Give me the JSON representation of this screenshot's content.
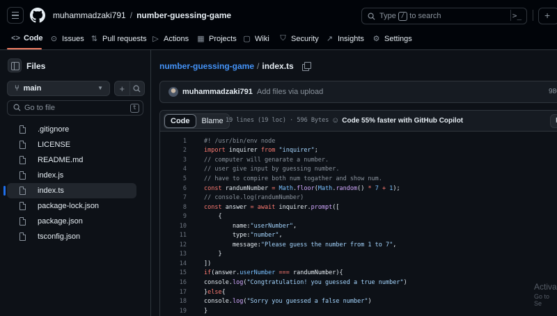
{
  "header": {
    "owner": "muhammadzaki791",
    "separator": "/",
    "repo": "number-guessing-game",
    "search_prefix": "Type",
    "search_key": "/",
    "search_suffix": "to search",
    "command_glyph": ">_",
    "plus_glyph": "+"
  },
  "nav": {
    "tabs": [
      {
        "label": "Code",
        "icon": "code-icon",
        "glyph": "<>"
      },
      {
        "label": "Issues",
        "icon": "issue-icon",
        "glyph": "⊙"
      },
      {
        "label": "Pull requests",
        "icon": "pull-request-icon",
        "glyph": "⇅"
      },
      {
        "label": "Actions",
        "icon": "play-icon",
        "glyph": "▷"
      },
      {
        "label": "Projects",
        "icon": "table-icon",
        "glyph": "▦"
      },
      {
        "label": "Wiki",
        "icon": "book-icon",
        "glyph": "▢"
      },
      {
        "label": "Security",
        "icon": "shield-icon",
        "glyph": "⛉"
      },
      {
        "label": "Insights",
        "icon": "graph-icon",
        "glyph": "↗"
      },
      {
        "label": "Settings",
        "icon": "gear-icon",
        "glyph": "⚙"
      }
    ],
    "active_tab": "Code"
  },
  "sidebar": {
    "title": "Files",
    "branch": "main",
    "add_glyph": "+",
    "goto_placeholder": "Go to file",
    "goto_key": "t",
    "files": [
      {
        "name": ".gitignore"
      },
      {
        "name": "LICENSE"
      },
      {
        "name": "README.md"
      },
      {
        "name": "index.js"
      },
      {
        "name": "index.ts",
        "selected": true
      },
      {
        "name": "package-lock.json"
      },
      {
        "name": "package.json"
      },
      {
        "name": "tsconfig.json"
      }
    ]
  },
  "main": {
    "breadcrumb_repo": "number-guessing-game",
    "breadcrumb_sep": "/",
    "breadcrumb_file": "index.ts",
    "commit": {
      "user": "muhammadzaki791",
      "message": "Add files via upload",
      "sha_partial": "980"
    },
    "code_view": {
      "tab_code": "Code",
      "tab_blame": "Blame",
      "meta": "19 lines (19 loc) · 596 Bytes",
      "copilot": "Code 55% faster with GitHub Copilot",
      "raw_partial": "R"
    },
    "code_lines": [
      "#! /usr/bin/env node",
      "import inquirer from \"inquirer\";",
      "// computer will genarate a number.",
      "// user give input by guessing number.",
      "// have to compire both num togather and show num.",
      "const randumNumber = Math.floor(Math.random() * 7 + 1);",
      "// console.log(randumNumber)",
      "const answer = await inquirer.prompt([",
      "    {",
      "        name:\"userNumber\",",
      "        type:\"number\",",
      "        message:\"Please guess the number from 1 to 7\",",
      "    }",
      "])",
      "if(answer.userNumber === randumNumber){",
      "console.log(\"Congtratulation! you guessed a true number\")",
      "}else{",
      "console.log(\"Sorry you guessed a false number\")",
      "}"
    ]
  },
  "watermark": {
    "line1": "Activa",
    "line2": "Go to Se"
  },
  "colors": {
    "background": "#0d1117",
    "header_bg": "#010409",
    "link": "#4493f8",
    "active_underline": "#f78166",
    "keyword": "#ff7b72",
    "string": "#a5d6ff",
    "comment": "#8b949e",
    "function": "#d2a8ff",
    "constant": "#79c0ff"
  }
}
